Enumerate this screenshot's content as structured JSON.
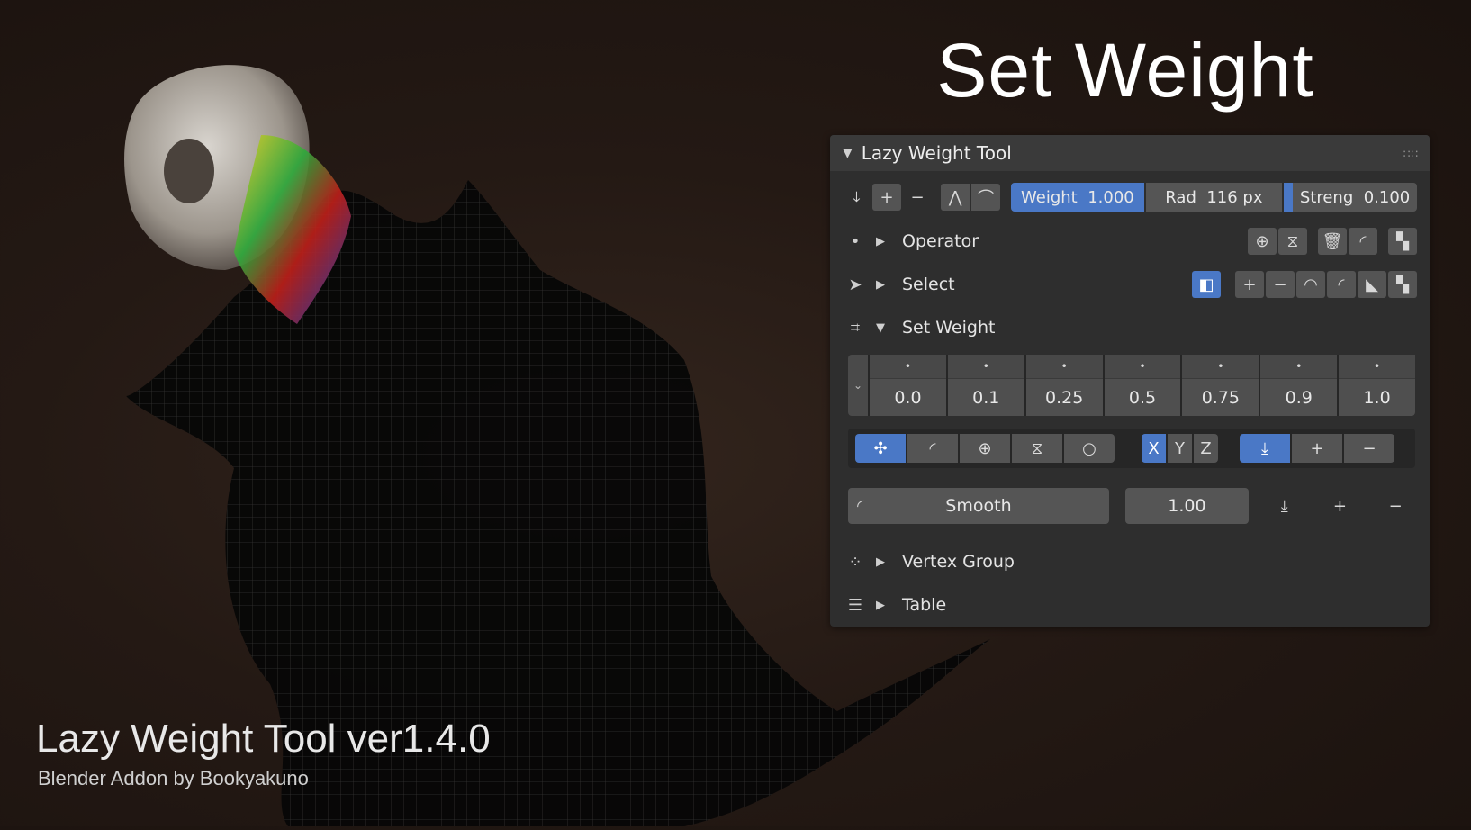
{
  "headline": "Set Weight",
  "branding": {
    "title": "Lazy Weight Tool ver1.4.0",
    "subtitle": "Blender Addon by Bookyakuno"
  },
  "panel": {
    "title": "Lazy Weight Tool",
    "toolbar": {
      "weight_label": "Weight",
      "weight_value": "1.000",
      "radius_label": "Rad",
      "radius_value": "116 px",
      "strength_label": "Streng",
      "strength_value": "0.100",
      "icons": [
        "download-icon",
        "plus-icon",
        "minus-icon",
        "curve-sharp-icon",
        "curve-flat-icon"
      ]
    },
    "sections": {
      "operator": {
        "label": "Operator"
      },
      "select": {
        "label": "Select"
      },
      "set_weight": {
        "label": "Set Weight"
      },
      "vertex_group": {
        "label": "Vertex Group"
      },
      "table": {
        "label": "Table"
      }
    },
    "presets": [
      "0.0",
      "0.1",
      "0.25",
      "0.5",
      "0.75",
      "0.9",
      "1.0"
    ],
    "axes": [
      "X",
      "Y",
      "Z"
    ],
    "smooth": {
      "label": "Smooth",
      "value": "1.00"
    }
  },
  "colors": {
    "accent": "#4a78c6",
    "panel": "#2e2e2e",
    "header": "#3a3a3a"
  }
}
